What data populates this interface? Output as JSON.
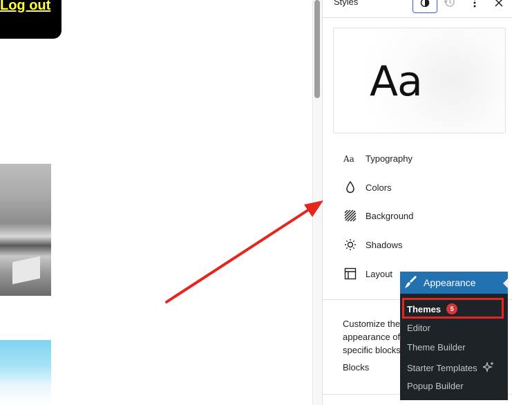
{
  "canvas": {
    "logout_label": "Log out"
  },
  "panel": {
    "title": "Styles",
    "header_buttons": {
      "styles_icon": "half-circle-icon",
      "revisions_icon": "history-icon",
      "options_icon": "more-vertical-icon",
      "close_icon": "close-icon"
    },
    "preview_text": "Aa",
    "nav_items": [
      {
        "label": "Typography",
        "icon": "typography-icon"
      },
      {
        "label": "Colors",
        "icon": "droplet-icon"
      },
      {
        "label": "Background",
        "icon": "background-icon"
      },
      {
        "label": "Shadows",
        "icon": "sun-icon"
      },
      {
        "label": "Layout",
        "icon": "layout-icon"
      }
    ],
    "customize_text": "Customize the appearance of specific blocks",
    "blocks_label": "Blocks"
  },
  "flyout": {
    "header_label": "Appearance",
    "items": [
      {
        "label": "Themes",
        "badge": "5",
        "current": true
      },
      {
        "label": "Editor"
      },
      {
        "label": "Theme Builder"
      },
      {
        "label": "Starter Templates",
        "icon": "sparkle-icon"
      },
      {
        "label": "Popup Builder"
      }
    ]
  },
  "colors": {
    "admin_blue": "#2271b1",
    "admin_dark": "#1d2327",
    "annotation_red": "#e5261f",
    "wp_accent": "#3858e9",
    "logout_yellow": "#ffff3b"
  }
}
